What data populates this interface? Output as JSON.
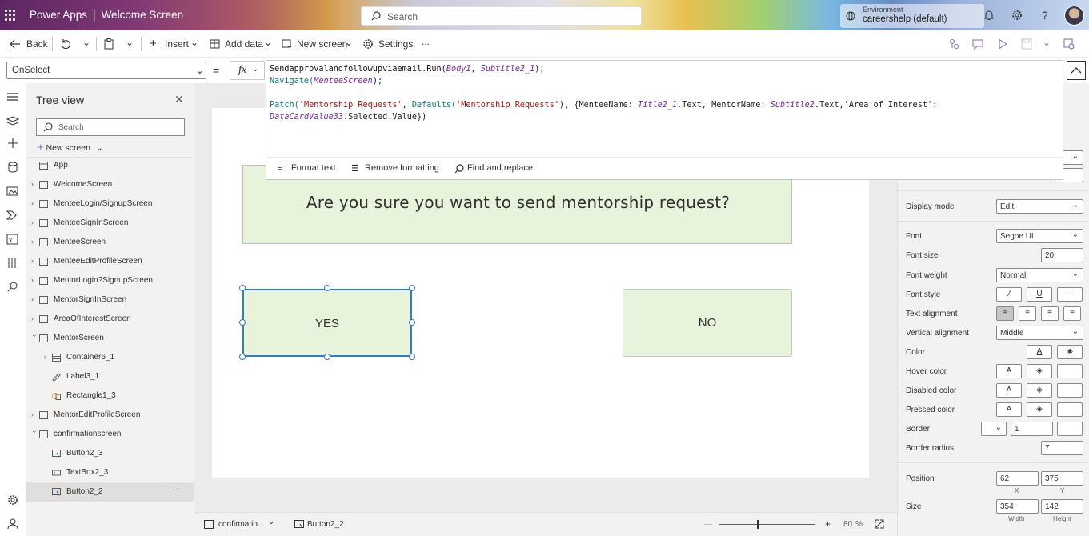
{
  "header": {
    "app_name": "Power Apps",
    "screen_name": "Welcome Screen",
    "search_placeholder": "Search",
    "environment_label": "Environment",
    "environment_value": "careershelp (default)"
  },
  "toolbar": {
    "back": "Back",
    "insert": "Insert",
    "add_data": "Add data",
    "new_screen": "New screen",
    "settings": "Settings",
    "more": "..."
  },
  "formula": {
    "property": "OnSelect",
    "equals": "=",
    "fx": "fx",
    "lines": [
      "Sendapprovalandfollowupviaemail.Run(Body1, Subtitle2_1);",
      "Navigate(MenteeScreen);",
      "",
      "Patch('Mentorship Requests', Defaults('Mentorship Requests'), {MenteeName: Title2_1.Text, MentorName: Subtitle2.Text,'Area of Interest':",
      "DataCardValue33.Selected.Value})"
    ],
    "footer": {
      "format_text": "Format text",
      "remove_formatting": "Remove formatting",
      "find_replace": "Find and replace"
    }
  },
  "tree": {
    "title": "Tree view",
    "search_placeholder": "Search",
    "new_screen": "New screen",
    "items": [
      {
        "label": "App",
        "level": 0,
        "chevron": "",
        "icon": "app"
      },
      {
        "label": "WelcomeScreen",
        "level": 0,
        "chevron": "›",
        "icon": "screen"
      },
      {
        "label": "MenteeLogin/SignupScreen",
        "level": 0,
        "chevron": "›",
        "icon": "screen"
      },
      {
        "label": "MenteeSignInScreen",
        "level": 0,
        "chevron": "›",
        "icon": "screen"
      },
      {
        "label": "MenteeScreen",
        "level": 0,
        "chevron": "›",
        "icon": "screen"
      },
      {
        "label": "MenteeEditProfileScreen",
        "level": 0,
        "chevron": "›",
        "icon": "screen"
      },
      {
        "label": "MentorLogin?SignupScreen",
        "level": 0,
        "chevron": "›",
        "icon": "screen"
      },
      {
        "label": "MentorSignInScreen",
        "level": 0,
        "chevron": "›",
        "icon": "screen"
      },
      {
        "label": "AreaOfInterestScreen",
        "level": 0,
        "chevron": "›",
        "icon": "screen"
      },
      {
        "label": "MentorScreen",
        "level": 0,
        "chevron": "⌄",
        "icon": "screen"
      },
      {
        "label": "Container6_1",
        "level": 1,
        "chevron": "›",
        "icon": "container"
      },
      {
        "label": "Label3_1",
        "level": 1,
        "chevron": "",
        "icon": "label"
      },
      {
        "label": "Rectangle1_3",
        "level": 1,
        "chevron": "",
        "icon": "shape"
      },
      {
        "label": "MentorEditProfileScreen",
        "level": 0,
        "chevron": "›",
        "icon": "screen"
      },
      {
        "label": "confirmationscreen",
        "level": 0,
        "chevron": "⌄",
        "icon": "screen"
      },
      {
        "label": "Button2_3",
        "level": 1,
        "chevron": "",
        "icon": "button"
      },
      {
        "label": "TextBox2_3",
        "level": 1,
        "chevron": "",
        "icon": "textbox"
      },
      {
        "label": "Button2_2",
        "level": 1,
        "chevron": "",
        "icon": "button",
        "selected": true
      }
    ],
    "selected_more": "···"
  },
  "canvas": {
    "question": "Are you sure you want to send mentorship request?",
    "yes_label": "YES",
    "no_label": "NO"
  },
  "bottom": {
    "screen_select": "confirmatio...",
    "breadcrumb_control": "Button2_2",
    "zoom": "80",
    "zoom_unit": "%"
  },
  "properties": {
    "display_mode_label": "Display mode",
    "display_mode": "Edit",
    "font_label": "Font",
    "font": "Segoe UI",
    "font_size_label": "Font size",
    "font_size": "20",
    "font_weight_label": "Font weight",
    "font_weight": "Normal",
    "font_style_label": "Font style",
    "font_style_buttons": [
      "/",
      "U",
      "—"
    ],
    "text_alignment_label": "Text alignment",
    "vertical_alignment_label": "Vertical alignment",
    "vertical_alignment": "Middle",
    "color_label": "Color",
    "hover_color_label": "Hover color",
    "disabled_color_label": "Disabled color",
    "pressed_color_label": "Pressed color",
    "color_text_glyph": "A",
    "border_label": "Border",
    "border_value": "1",
    "border_radius_label": "Border radius",
    "border_radius": "7",
    "position_label": "Position",
    "position_x": "62",
    "position_y": "375",
    "x_label": "X",
    "y_label": "Y",
    "size_label": "Size",
    "size_width": "354",
    "size_height": "142",
    "width_label": "Width",
    "height_label": "Height"
  },
  "colors": {
    "button_fill": "#e8f3dc",
    "selection": "#2f7ad4",
    "canvas_bg": "#edebe9"
  }
}
